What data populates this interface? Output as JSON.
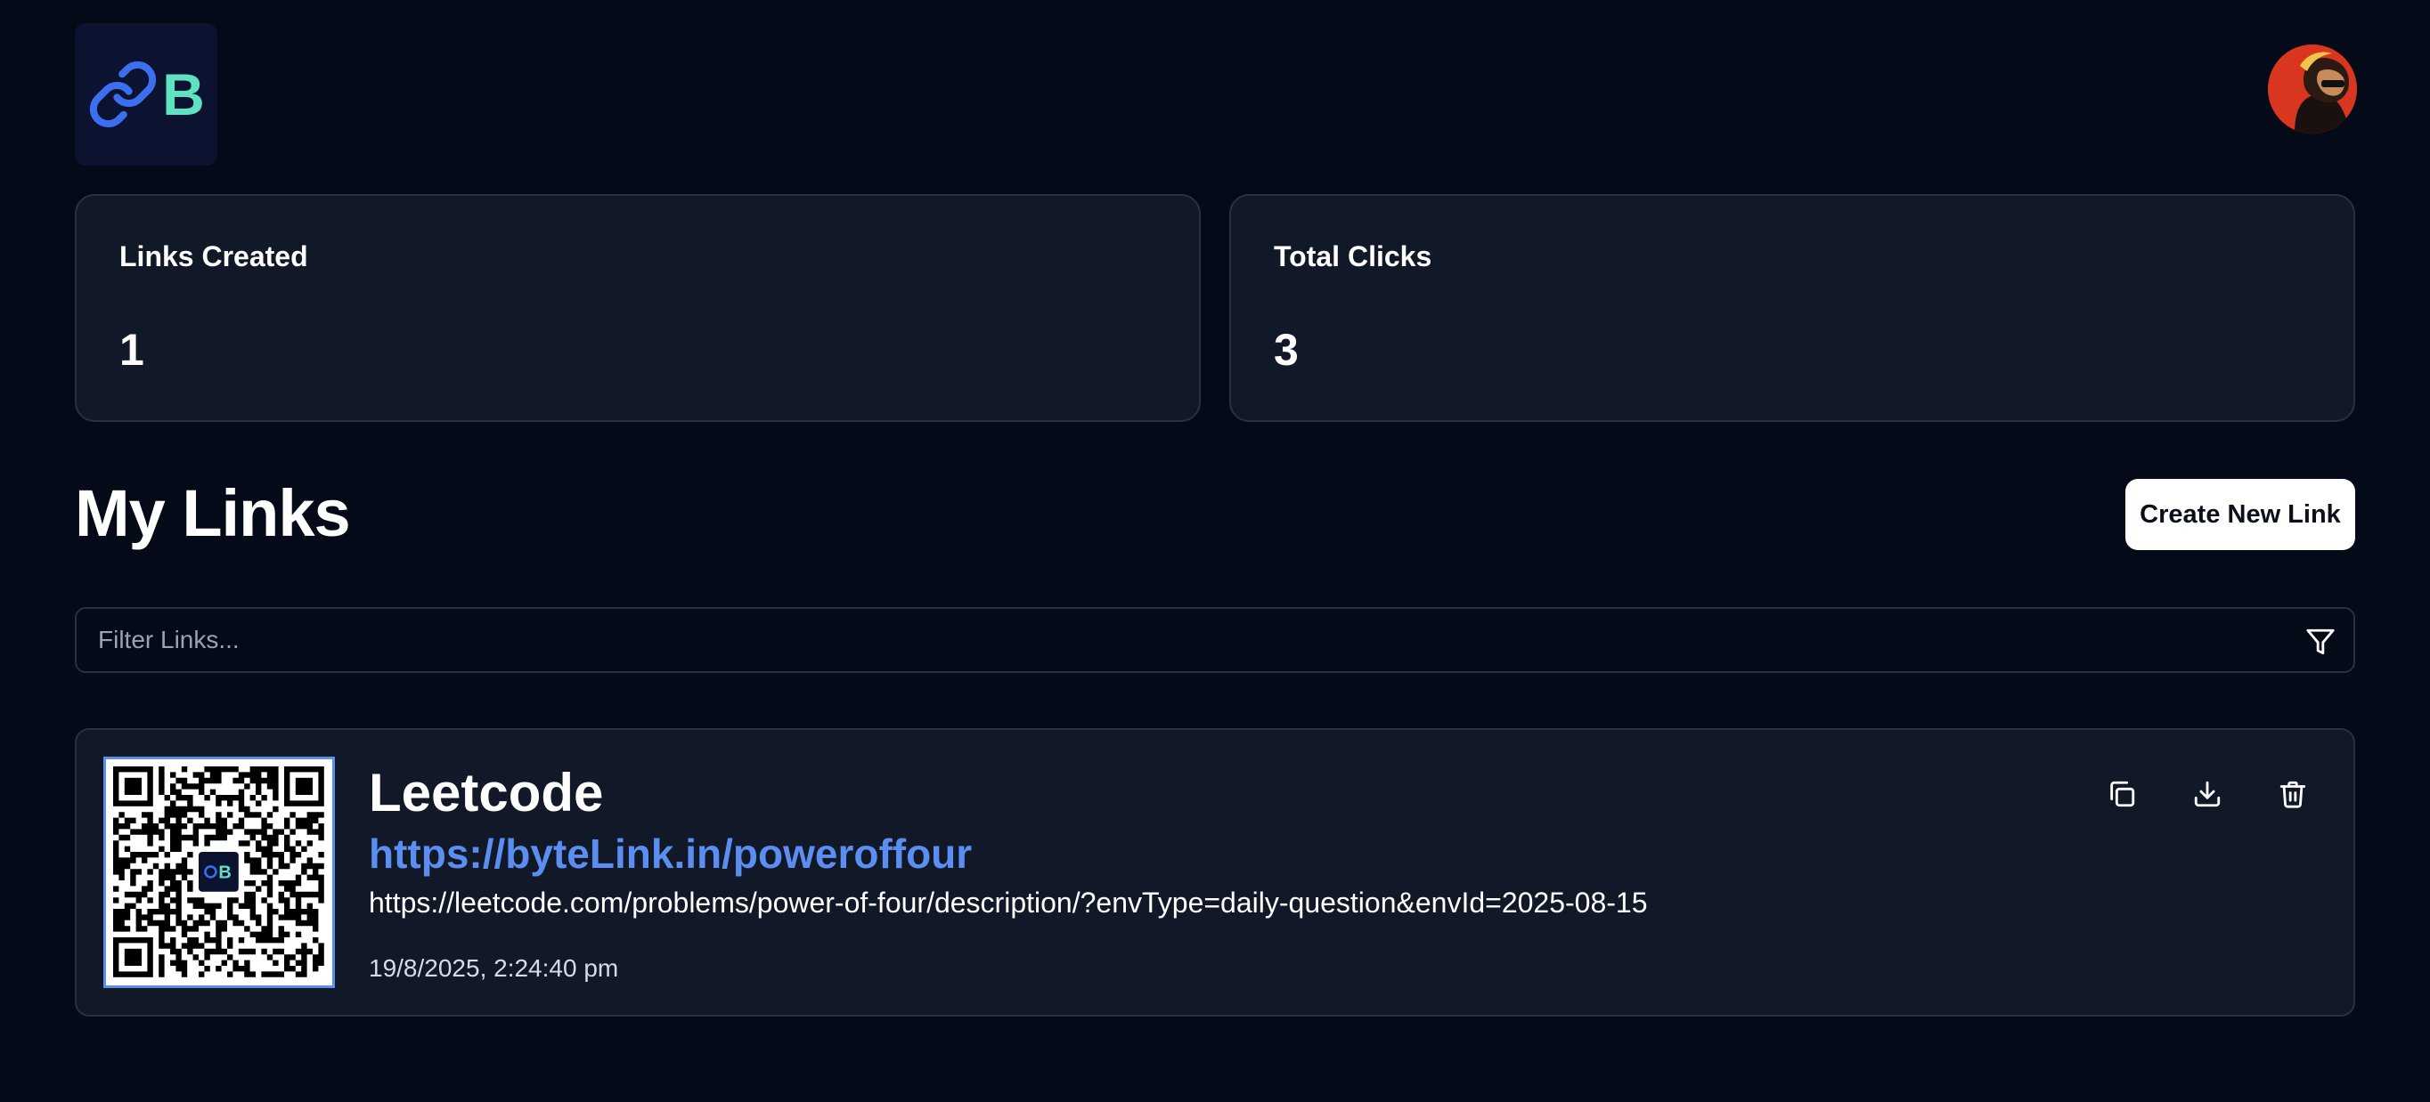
{
  "header": {
    "logo_letter": "B",
    "logo_icon": "link-icon",
    "avatar_icon": "user-avatar"
  },
  "stats": [
    {
      "label": "Links Created",
      "value": "1"
    },
    {
      "label": "Total Clicks",
      "value": "3"
    }
  ],
  "section": {
    "title": "My Links",
    "create_button_label": "Create New Link"
  },
  "filter": {
    "placeholder": "Filter Links...",
    "value": "",
    "icon": "filter-icon"
  },
  "links": [
    {
      "title": "Leetcode",
      "short_url": "https://byteLink.in/poweroffour",
      "original_url": "https://leetcode.com/problems/power-of-four/description/?envType=daily-question&envId=2025-08-15",
      "created_at": "19/8/2025, 2:24:40 pm",
      "qr_center_letter": "B",
      "actions": [
        "copy-icon",
        "download-icon",
        "trash-icon"
      ]
    }
  ],
  "colors": {
    "background": "#050a18",
    "card": "#111827",
    "border": "#273142",
    "accent_link": "#5b8ef0",
    "logo_teal": "#5fe2c2",
    "logo_blue": "#3b6ff0"
  }
}
